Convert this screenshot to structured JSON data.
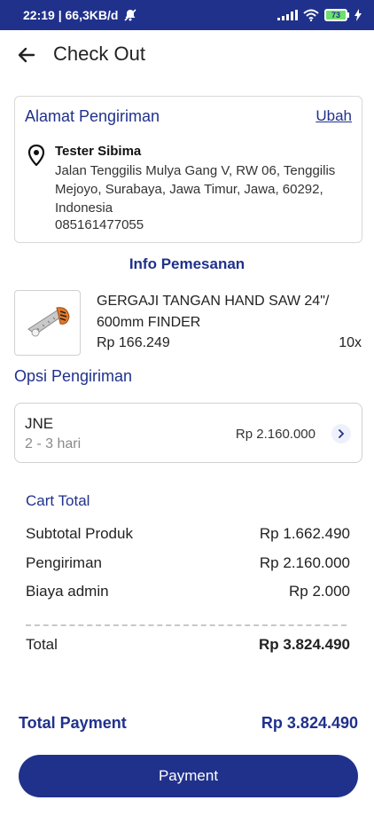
{
  "status_bar": {
    "time_speed": "22:19 | 66,3KB/d",
    "battery_level": "73",
    "icons": [
      "mute-bell-icon",
      "signal-icon",
      "wifi-icon",
      "battery-icon",
      "charging-icon"
    ]
  },
  "header": {
    "title": "Check Out",
    "back_icon": "arrow-left-icon"
  },
  "address": {
    "title": "Alamat Pengiriman",
    "edit_label": "Ubah",
    "icon": "location-pin-icon",
    "name": "Tester Sibima",
    "full_address": "Jalan Tenggilis Mulya Gang V, RW 06, Tenggilis Mejoyo, Surabaya, Jawa Timur, Jawa, 60292, Indonesia",
    "phone": "085161477055"
  },
  "order_info": {
    "title": "Info Pemesanan",
    "product": {
      "name": "GERGAJI TANGAN HAND SAW 24\"/ 600mm FINDER",
      "price": "Rp 166.249",
      "quantity": "10x",
      "image_icon": "hand-saw-icon"
    }
  },
  "shipping": {
    "title": "Opsi Pengiriman",
    "courier": "JNE",
    "eta": "2 - 3 hari",
    "price": "Rp 2.160.000",
    "arrow_icon": "chevron-right-icon"
  },
  "cart_total": {
    "title": "Cart Total",
    "rows": [
      {
        "label": "Subtotal Produk",
        "value": "Rp 1.662.490"
      },
      {
        "label": "Pengiriman",
        "value": "Rp 2.160.000"
      },
      {
        "label": "Biaya admin",
        "value": "Rp 2.000"
      }
    ],
    "total_label": "Total",
    "total_value": "Rp 3.824.490"
  },
  "payment": {
    "label": "Total Payment",
    "value": "Rp 3.824.490",
    "button_label": "Payment"
  },
  "colors": {
    "primary": "#20318c",
    "muted": "#8a8a8a",
    "border": "#d8d8d8"
  }
}
